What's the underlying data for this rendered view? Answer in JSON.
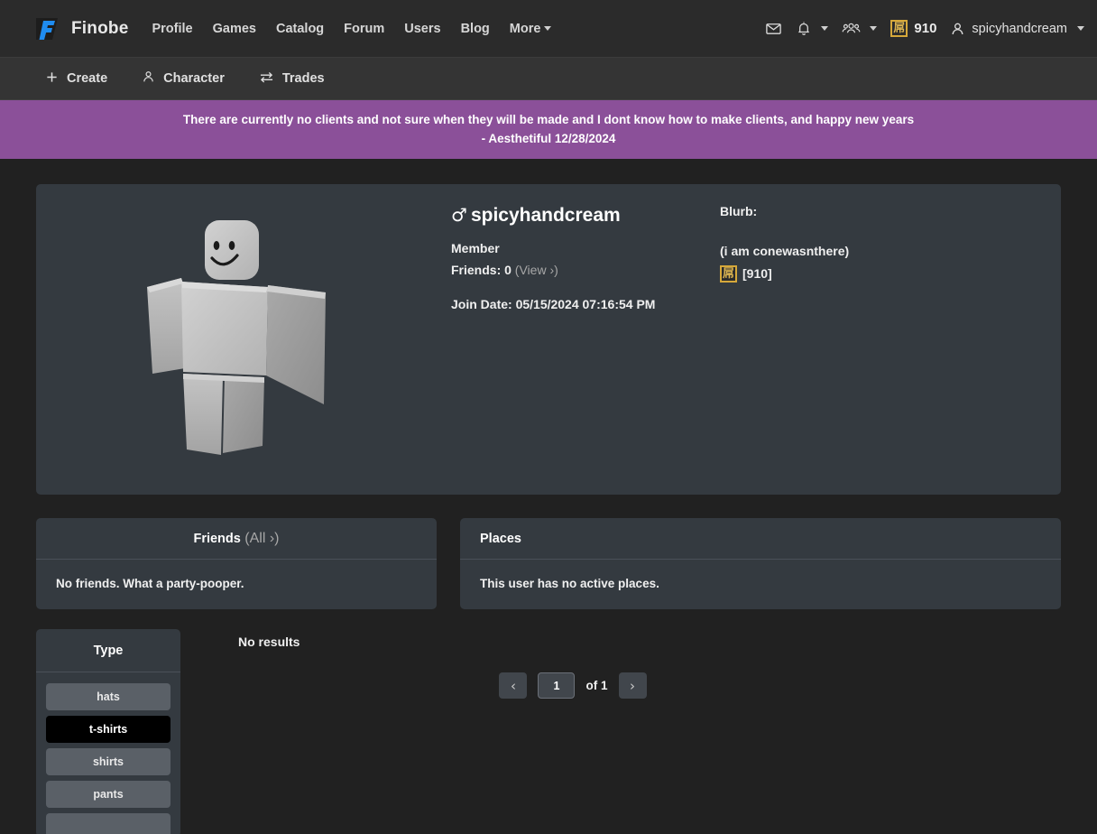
{
  "navbar": {
    "brand": "Finobe",
    "logo_icon": "finobe-logo-icon",
    "links": [
      {
        "label": "Profile",
        "name": "nav-link-profile"
      },
      {
        "label": "Games",
        "name": "nav-link-games"
      },
      {
        "label": "Catalog",
        "name": "nav-link-catalog"
      },
      {
        "label": "Forum",
        "name": "nav-link-forum"
      },
      {
        "label": "Users",
        "name": "nav-link-users"
      },
      {
        "label": "Blog",
        "name": "nav-link-blog"
      },
      {
        "label": "More",
        "name": "nav-link-more"
      }
    ],
    "messages_icon": "envelope-icon",
    "notifications_icon": "bell-icon",
    "friends_icon": "people-icon",
    "currency_icon": "finobux-coin-icon",
    "currency_glyph": "屌",
    "currency_amount": "910",
    "user_icon": "user-icon",
    "username": "spicyhandcream"
  },
  "subnav": {
    "items": [
      {
        "label": "Create",
        "icon": "plus-icon",
        "name": "subnav-item-create"
      },
      {
        "label": "Character",
        "icon": "person-icon",
        "name": "subnav-item-character"
      },
      {
        "label": "Trades",
        "icon": "exchange-arrows-icon",
        "name": "subnav-item-trades"
      }
    ]
  },
  "banner": {
    "line1": "There are currently no clients and not sure when they will be made and I dont know how to make clients, and happy new years",
    "line2": "- Aesthetiful 12/28/2024",
    "color": "#8b5099"
  },
  "profile": {
    "gender_symbol": "♂",
    "username": "spicyhandcream",
    "rank": "Member",
    "friends_label": "Friends: 0",
    "friends_link": "(View ›)",
    "join_date": "Join Date: 05/15/2024 07:16:54 PM",
    "avatar_icon": "avatar-character-render",
    "blurb_label": "Blurb:",
    "blurb_text": "(i am conewasnthere)",
    "blurb_currency": "[910]",
    "blurb_currency_glyph": "屌"
  },
  "friends_panel": {
    "title": "Friends",
    "all_link": "(All ›)",
    "empty_text": "No friends. What a party-pooper."
  },
  "places_panel": {
    "title": "Places",
    "empty_text": "This user has no active places."
  },
  "type_panel": {
    "title": "Type",
    "buttons": [
      {
        "label": "hats",
        "active": false
      },
      {
        "label": "t-shirts",
        "active": true
      },
      {
        "label": "shirts",
        "active": false
      },
      {
        "label": "pants",
        "active": false
      },
      {
        "label": "",
        "active": false
      }
    ]
  },
  "results": {
    "empty_text": "No results",
    "prev_icon": "chevron-left-icon",
    "next_icon": "chevron-right-icon",
    "page_value": "1",
    "page_total": "of 1"
  },
  "colors": {
    "page_bg": "#212121",
    "navbar_bg": "#2b2b2b",
    "subnav_bg": "#343434",
    "card_bg": "#343a40",
    "accent_purple": "#8b5099",
    "coin_gold": "#d6a83a",
    "brand_blue": "#1f8cf0"
  }
}
